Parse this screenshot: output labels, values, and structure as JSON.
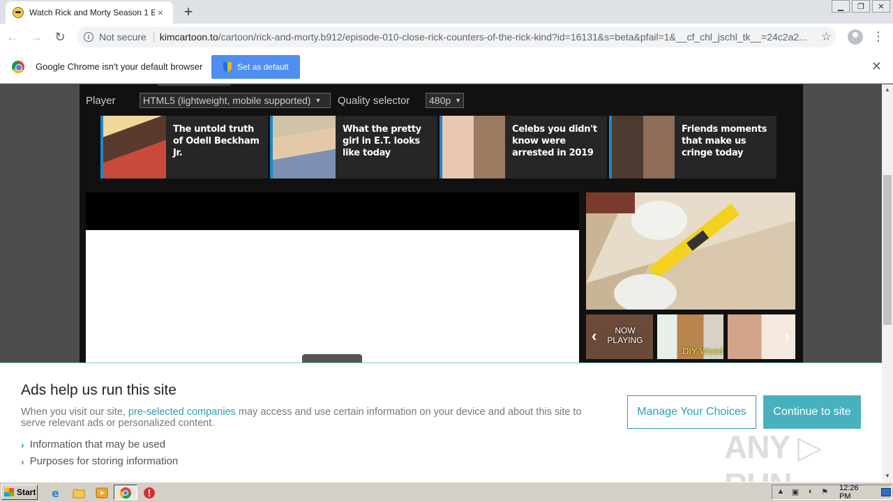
{
  "browser": {
    "tab_title": "Watch Rick and Morty Season 1 Epis",
    "tab_close": "×",
    "new_tab": "+",
    "window_controls": [
      "▁",
      "❐",
      "✕"
    ],
    "not_secure": "Not secure",
    "url_host": "kimcartoon.to",
    "url_path": "/cartoon/rick-and-morty.b912/episode-010-close-rick-counters-of-the-rick-kind?id=16131&s=beta&pfail=1&__cf_chl_jschl_tk__=24c2a2...",
    "infobar_text": "Google Chrome isn't your default browser",
    "set_default_label": "Set as default",
    "infobar_close": "✕"
  },
  "player": {
    "player_label": "Player",
    "player_value": "HTML5 (lightweight, mobile supported)",
    "quality_label": "Quality selector",
    "quality_value": "480p"
  },
  "ads": [
    {
      "text": "The untold truth of Odell Beckham Jr.",
      "color": "#c94a3a"
    },
    {
      "text": "What the pretty girl in E.T. looks like today",
      "color": "#b59572"
    },
    {
      "text": "Celebs you didn't know were arrested in 2019",
      "color": "#c9a58c"
    },
    {
      "text": "Friends moments that make us cringe today",
      "color": "#6e5644"
    }
  ],
  "side_player": {
    "now_playing": "NOW PLAYING",
    "thumb2_caption": "DIY Wood"
  },
  "consent": {
    "title": "Ads help us run this site",
    "body_before": "When you visit our site, ",
    "body_link": "pre-selected companies",
    "body_after": " may access and use certain information on your device and about this site to serve relevant ads or personalized content.",
    "item1": "Information that may be used",
    "item2": "Purposes for storing information",
    "manage_label": "Manage Your Choices",
    "continue_label": "Continue to site",
    "watermark": "ANY ▷ RUN"
  },
  "taskbar": {
    "start_label": "Start",
    "clock": "12:26 PM"
  }
}
